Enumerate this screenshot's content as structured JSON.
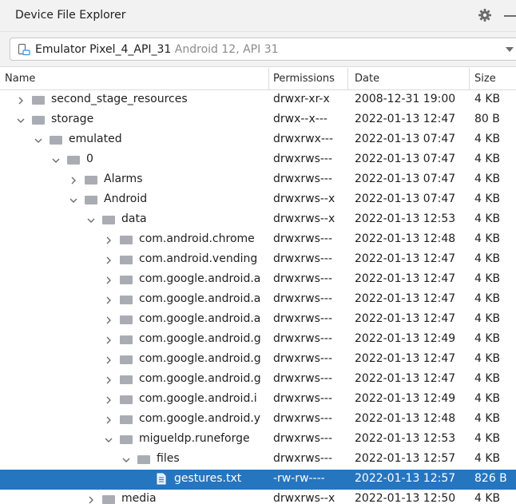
{
  "window": {
    "title": "Device File Explorer"
  },
  "icons": {
    "settings": "gear-icon",
    "minimize": "minimize-icon",
    "device": "phone-device-icon",
    "dropdown": "chevron-down-icon",
    "folder": "folder-icon",
    "file": "text-file-icon"
  },
  "device": {
    "name": "Emulator Pixel_4_API_31",
    "details": "Android 12, API 31"
  },
  "columns": {
    "name": "Name",
    "permissions": "Permissions",
    "date": "Date",
    "size": "Size"
  },
  "colors": {
    "selection": "#2675bf",
    "folder": "#a9adb3",
    "header_bg": "#f2f2f2"
  },
  "rows": [
    {
      "name": "second_stage_resources",
      "permissions": "drwxr-xr-x",
      "date": "2008-12-31 19:00",
      "size": "4 KB",
      "depth": 0,
      "expanded": false,
      "type": "folder"
    },
    {
      "name": "storage",
      "permissions": "drwx--x---",
      "date": "2022-01-13 12:47",
      "size": "80 B",
      "depth": 0,
      "expanded": true,
      "type": "folder"
    },
    {
      "name": "emulated",
      "permissions": "drwxrwx---",
      "date": "2022-01-13 07:47",
      "size": "4 KB",
      "depth": 1,
      "expanded": true,
      "type": "folder"
    },
    {
      "name": "0",
      "permissions": "drwxrws---",
      "date": "2022-01-13 07:47",
      "size": "4 KB",
      "depth": 2,
      "expanded": true,
      "type": "folder"
    },
    {
      "name": "Alarms",
      "permissions": "drwxrws---",
      "date": "2022-01-13 07:47",
      "size": "4 KB",
      "depth": 3,
      "expanded": false,
      "type": "folder"
    },
    {
      "name": "Android",
      "permissions": "drwxrws--x",
      "date": "2022-01-13 07:47",
      "size": "4 KB",
      "depth": 3,
      "expanded": true,
      "type": "folder"
    },
    {
      "name": "data",
      "permissions": "drwxrws--x",
      "date": "2022-01-13 12:53",
      "size": "4 KB",
      "depth": 4,
      "expanded": true,
      "type": "folder"
    },
    {
      "name": "com.android.chrome",
      "permissions": "drwxrws---",
      "date": "2022-01-13 12:48",
      "size": "4 KB",
      "depth": 5,
      "expanded": false,
      "type": "folder"
    },
    {
      "name": "com.android.vending",
      "permissions": "drwxrws---",
      "date": "2022-01-13 12:47",
      "size": "4 KB",
      "depth": 5,
      "expanded": false,
      "type": "folder"
    },
    {
      "name": "com.google.android.a",
      "permissions": "drwxrws---",
      "date": "2022-01-13 12:47",
      "size": "4 KB",
      "depth": 5,
      "expanded": false,
      "type": "folder"
    },
    {
      "name": "com.google.android.a",
      "permissions": "drwxrws---",
      "date": "2022-01-13 12:47",
      "size": "4 KB",
      "depth": 5,
      "expanded": false,
      "type": "folder"
    },
    {
      "name": "com.google.android.a",
      "permissions": "drwxrws---",
      "date": "2022-01-13 12:47",
      "size": "4 KB",
      "depth": 5,
      "expanded": false,
      "type": "folder"
    },
    {
      "name": "com.google.android.g",
      "permissions": "drwxrws---",
      "date": "2022-01-13 12:49",
      "size": "4 KB",
      "depth": 5,
      "expanded": false,
      "type": "folder"
    },
    {
      "name": "com.google.android.g",
      "permissions": "drwxrws---",
      "date": "2022-01-13 12:47",
      "size": "4 KB",
      "depth": 5,
      "expanded": false,
      "type": "folder"
    },
    {
      "name": "com.google.android.g",
      "permissions": "drwxrws---",
      "date": "2022-01-13 12:47",
      "size": "4 KB",
      "depth": 5,
      "expanded": false,
      "type": "folder"
    },
    {
      "name": "com.google.android.i",
      "permissions": "drwxrws---",
      "date": "2022-01-13 12:49",
      "size": "4 KB",
      "depth": 5,
      "expanded": false,
      "type": "folder"
    },
    {
      "name": "com.google.android.y",
      "permissions": "drwxrws---",
      "date": "2022-01-13 12:48",
      "size": "4 KB",
      "depth": 5,
      "expanded": false,
      "type": "folder"
    },
    {
      "name": "migueldp.runeforge",
      "permissions": "drwxrws---",
      "date": "2022-01-13 12:53",
      "size": "4 KB",
      "depth": 5,
      "expanded": true,
      "type": "folder"
    },
    {
      "name": "files",
      "permissions": "drwxrws---",
      "date": "2022-01-13 12:57",
      "size": "4 KB",
      "depth": 6,
      "expanded": true,
      "type": "folder"
    },
    {
      "name": "gestures.txt",
      "permissions": "-rw-rw----",
      "date": "2022-01-13 12:57",
      "size": "826 B",
      "depth": 7,
      "expanded": false,
      "type": "file",
      "selected": true
    },
    {
      "name": "media",
      "permissions": "drwxrws--x",
      "date": "2022-01-13 12:50",
      "size": "4 KB",
      "depth": 4,
      "expanded": false,
      "type": "folder"
    }
  ]
}
